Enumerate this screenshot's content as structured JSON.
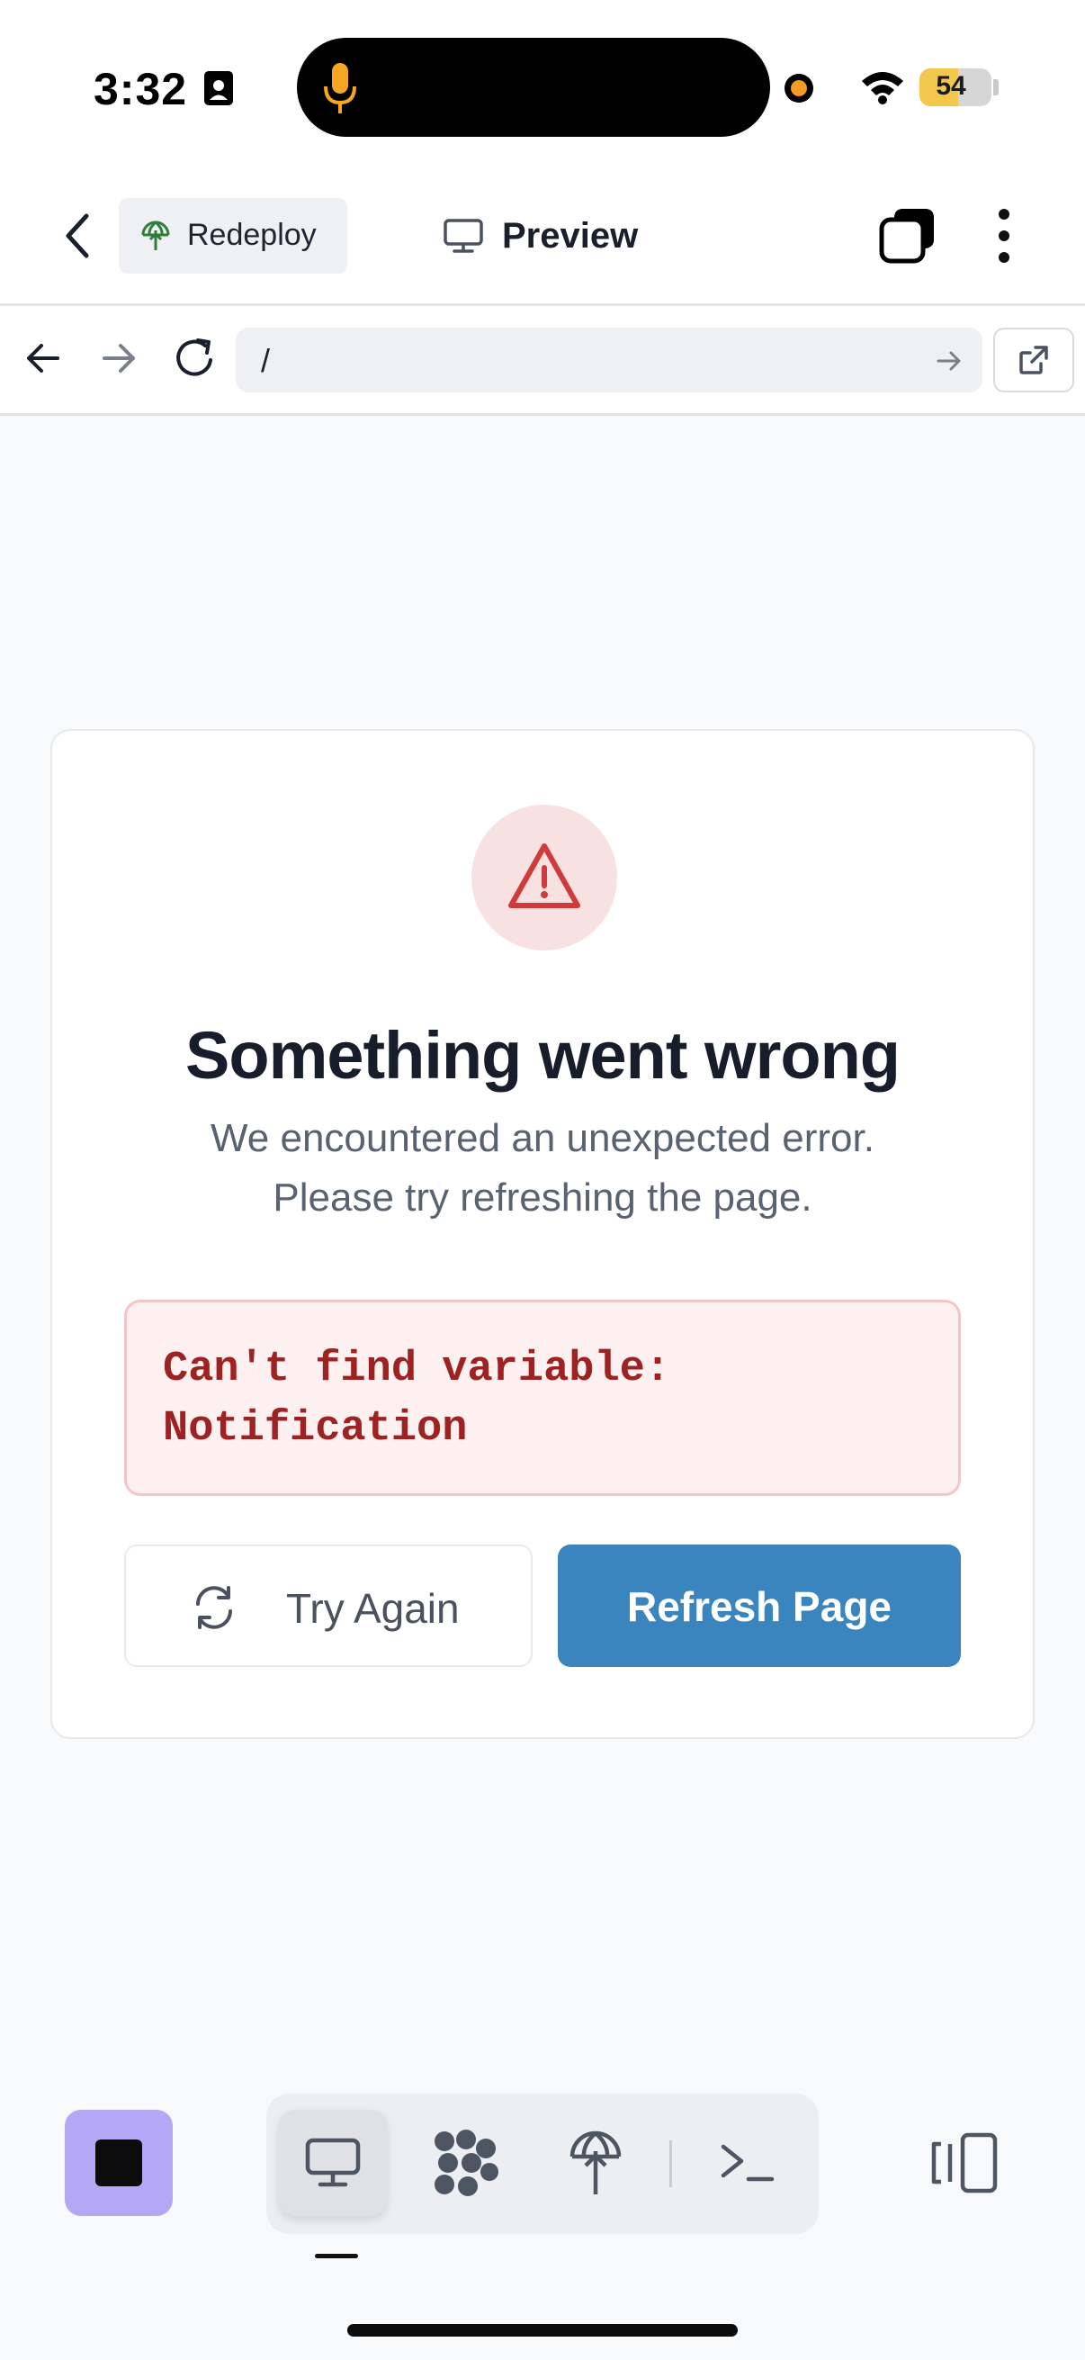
{
  "status_bar": {
    "time": "3:32",
    "battery_percent": "54",
    "battery_level": 0.54,
    "recording_indicator_color": "#f59a23"
  },
  "header": {
    "redeploy_label": "Redeploy",
    "title": "Preview",
    "icons": [
      "chevron-left-icon",
      "deploy-icon",
      "monitor-icon",
      "tabs-icon",
      "more-vertical-icon"
    ]
  },
  "url_bar": {
    "url": "/",
    "icons": [
      "arrow-left-icon",
      "arrow-right-icon",
      "reload-icon",
      "go-arrow-icon",
      "external-link-icon"
    ]
  },
  "error_card": {
    "title": "Something went wrong",
    "description_line1": "We encountered an unexpected error.",
    "description_line2": "Please try refreshing the page.",
    "error_message": "Can't find variable: Notification",
    "try_again_label": "Try Again",
    "refresh_label": "Refresh Page",
    "colors": {
      "accent": "#3a85bd",
      "error_text": "#9e2222",
      "error_bg": "#fdf0f0",
      "warning_icon": "#d03a3a"
    }
  },
  "toolbar": {
    "stop_button_color": "#b4a7f5",
    "modes": [
      "preview-mode",
      "graph-mode",
      "deploy-mode",
      "shell-mode"
    ],
    "active_mode": "preview-mode"
  }
}
